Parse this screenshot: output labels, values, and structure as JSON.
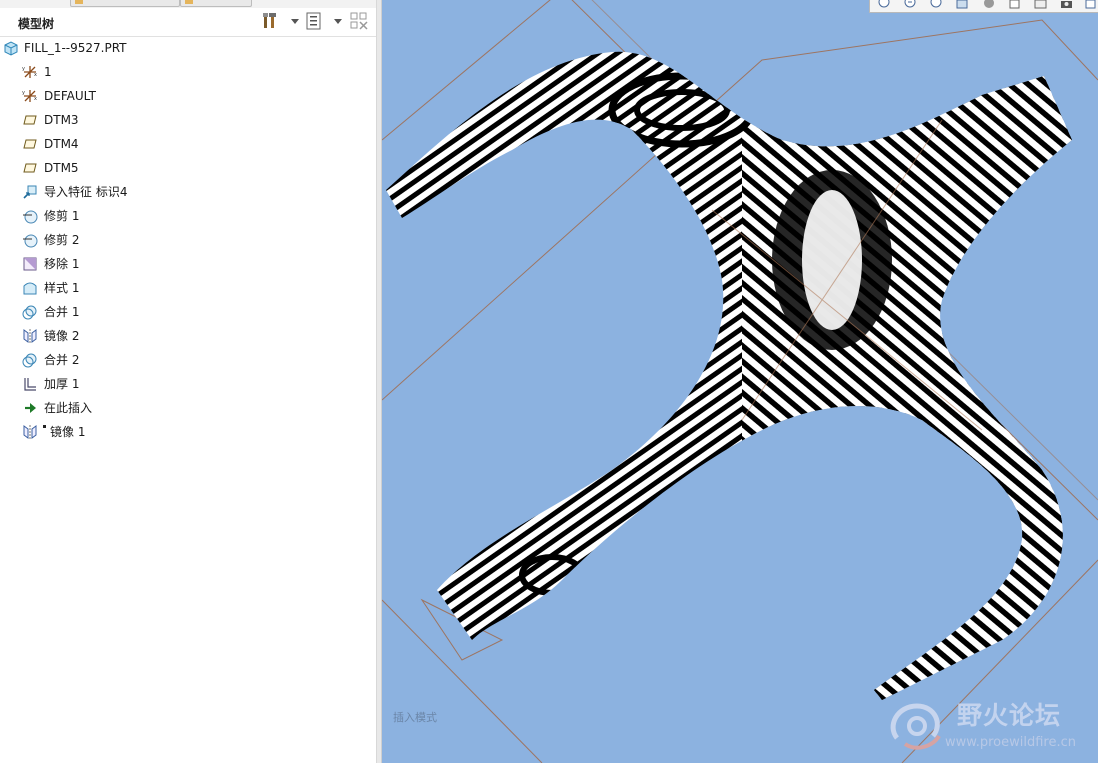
{
  "model_tree": {
    "title": "模型树",
    "items": [
      {
        "label": "FILL_1--9527.PRT",
        "icon": "part-icon"
      },
      {
        "label": "1",
        "icon": "coordinate-system-icon"
      },
      {
        "label": "DEFAULT",
        "icon": "coordinate-system-icon"
      },
      {
        "label": "DTM3",
        "icon": "datum-plane-icon"
      },
      {
        "label": "DTM4",
        "icon": "datum-plane-icon"
      },
      {
        "label": "DTM5",
        "icon": "datum-plane-icon"
      },
      {
        "label": "导入特征 标识4",
        "icon": "import-feature-icon"
      },
      {
        "label": "修剪 1",
        "icon": "trim-icon"
      },
      {
        "label": "修剪 2",
        "icon": "trim-icon"
      },
      {
        "label": "移除 1",
        "icon": "remove-icon"
      },
      {
        "label": "样式 1",
        "icon": "style-icon"
      },
      {
        "label": "合并 1",
        "icon": "merge-icon"
      },
      {
        "label": "镜像 2",
        "icon": "mirror-icon"
      },
      {
        "label": "合并 2",
        "icon": "merge-icon"
      },
      {
        "label": "加厚 1",
        "icon": "thicken-icon"
      },
      {
        "label": "在此插入",
        "icon": "insert-here-arrow-icon"
      },
      {
        "label": "镜像 1",
        "icon": "mirror-icon"
      }
    ]
  },
  "viewport": {
    "mode_label": "插入模式",
    "background_color": "#8cb2e0"
  },
  "watermark": {
    "title": "野火论坛",
    "url": "www.proewildfire.cn"
  }
}
